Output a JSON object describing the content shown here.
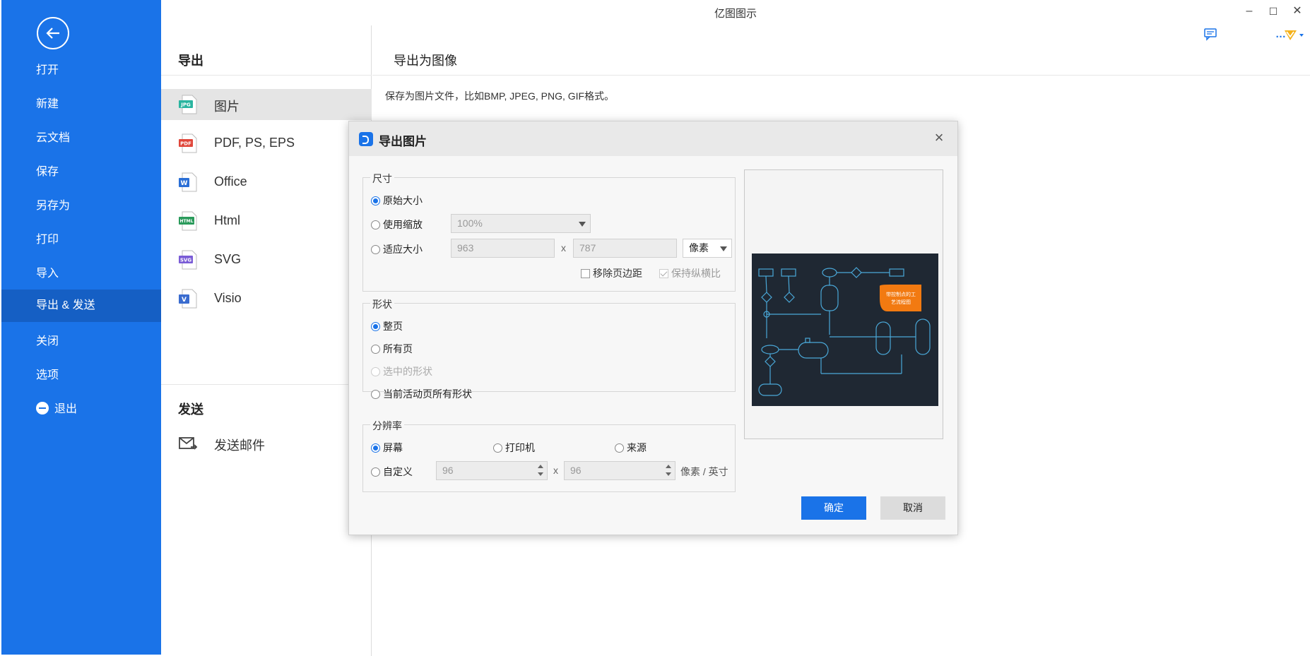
{
  "app": {
    "title": "亿图图示"
  },
  "nav": {
    "items": [
      "打开",
      "新建",
      "云文档",
      "保存",
      "另存为",
      "打印",
      "导入",
      "导出 & 发送",
      "关闭",
      "选项",
      "退出"
    ],
    "active_index": 7
  },
  "middle": {
    "export_title": "导出",
    "formats": [
      {
        "label": "图片",
        "icon": "jpg-file-icon",
        "badge": "JPG",
        "color": "#2bb5a0"
      },
      {
        "label": "PDF, PS, EPS",
        "icon": "pdf-file-icon",
        "badge": "PDF",
        "color": "#e0473b"
      },
      {
        "label": "Office",
        "icon": "word-file-icon",
        "badge": "W",
        "color": "#2b6fd6"
      },
      {
        "label": "Html",
        "icon": "html-file-icon",
        "badge": "HTML",
        "color": "#2a9a5b"
      },
      {
        "label": "SVG",
        "icon": "svg-file-icon",
        "badge": "SVG",
        "color": "#7a5cd6"
      },
      {
        "label": "Visio",
        "icon": "visio-file-icon",
        "badge": "V",
        "color": "#3a6ccf"
      }
    ],
    "send_title": "发送",
    "send_email": "发送邮件"
  },
  "right": {
    "title": "导出为图像",
    "description": "保存为图片文件，比如BMP, JPEG, PNG, GIF格式。"
  },
  "dialog": {
    "title": "导出图片",
    "size": {
      "title": "尺寸",
      "original": "原始大小",
      "use_zoom": "使用缩放",
      "zoom_value": "100%",
      "fit_size": "适应大小",
      "width": "963",
      "height": "787",
      "x_sep": "x",
      "unit": "像素",
      "remove_margin": "移除页边距",
      "keep_ratio": "保持纵横比"
    },
    "shape": {
      "title": "形状",
      "whole_page": "整页",
      "all_pages": "所有页",
      "selected": "选中的形状",
      "current_all": "当前活动页所有形状"
    },
    "resolution": {
      "title": "分辨率",
      "screen": "屏幕",
      "printer": "打印机",
      "source": "来源",
      "custom": "自定义",
      "dpi_x": "96",
      "dpi_y": "96",
      "x_sep": "x",
      "unit": "像素 / 英寸"
    },
    "preview": {
      "callout_line1": "带控制点的工",
      "callout_line2": "艺流程图"
    },
    "ok": "确定",
    "cancel": "取消"
  }
}
